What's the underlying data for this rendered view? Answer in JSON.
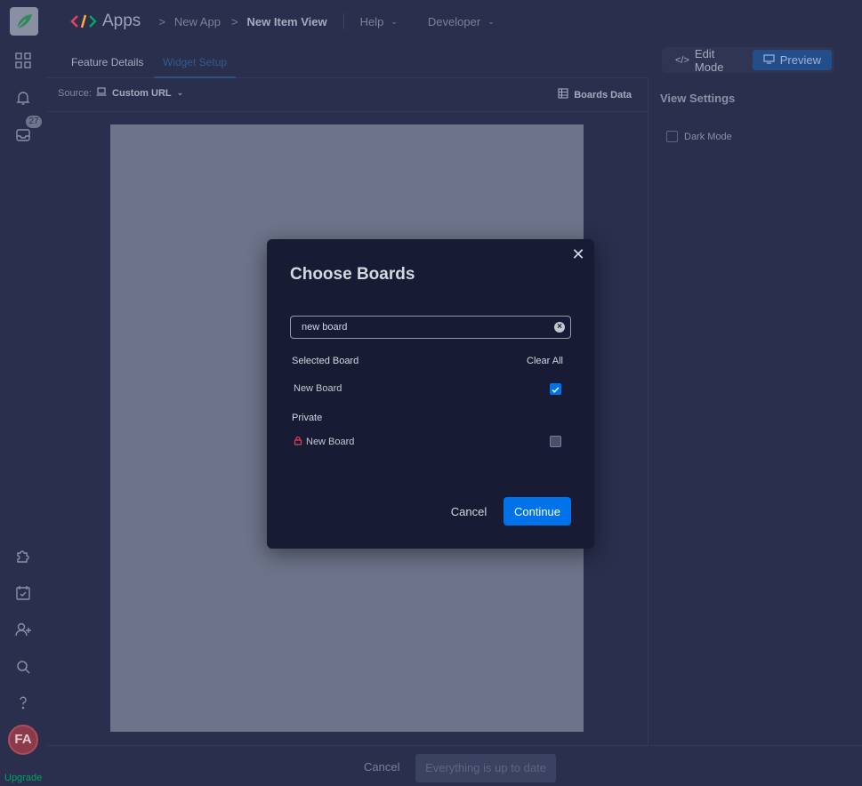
{
  "rail": {
    "badge_count": "27",
    "avatar_initials": "FA",
    "upgrade_label": "Upgrade"
  },
  "topbar": {
    "apps_title": "Apps",
    "crumb_app": "New App",
    "crumb_current": "New Item View",
    "help_label": "Help",
    "developer_label": "Developer"
  },
  "tabs": {
    "feature_details": "Feature Details",
    "widget_setup": "Widget Setup"
  },
  "modes": {
    "edit_label": "Edit Mode",
    "preview_label": "Preview"
  },
  "source": {
    "label": "Source:",
    "value": "Custom URL",
    "boards_data": "Boards Data"
  },
  "right_panel": {
    "title": "View Settings",
    "dark_mode_label": "Dark Mode"
  },
  "bottombar": {
    "cancel_label": "Cancel",
    "status_label": "Everything is up to date"
  },
  "modal": {
    "title": "Choose Boards",
    "search_value": "new board",
    "selected_header": "Selected Board",
    "clear_all": "Clear All",
    "selected_items": [
      {
        "label": "New Board",
        "checked": true
      }
    ],
    "private_header": "Private",
    "private_items": [
      {
        "label": "New Board",
        "checked": false
      }
    ],
    "cancel_label": "Cancel",
    "continue_label": "Continue"
  },
  "colors": {
    "primary": "#0073ea",
    "background": "#292f4c",
    "modal_background": "#181b34",
    "upgrade_green": "#00a663",
    "lock_red": "#e2445c"
  }
}
